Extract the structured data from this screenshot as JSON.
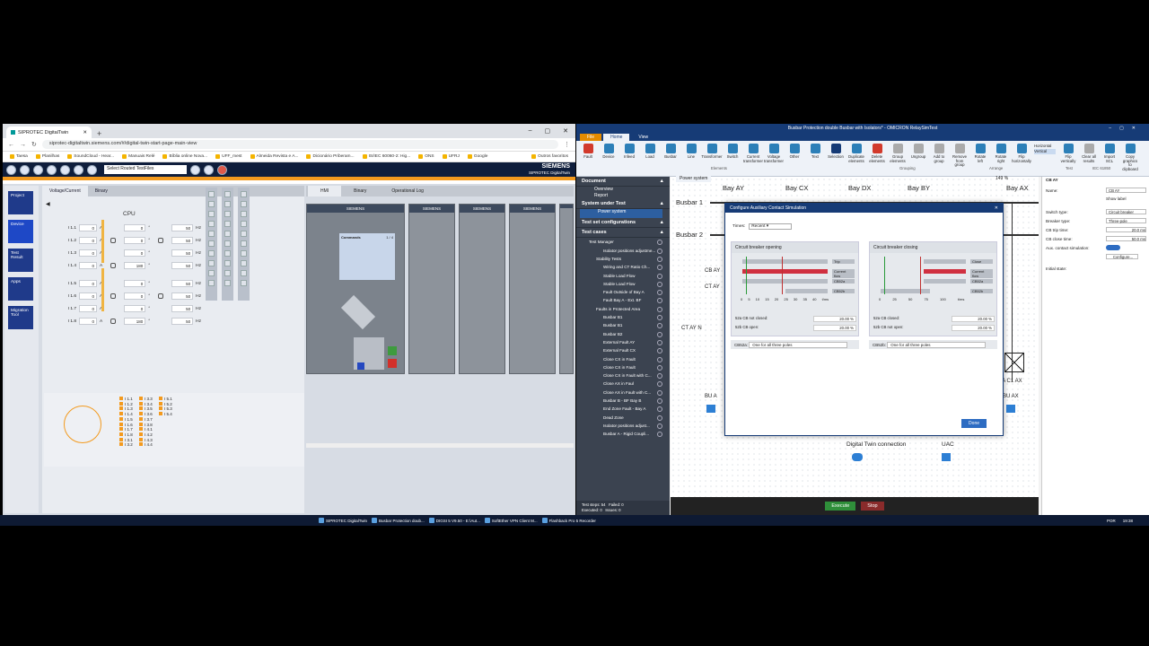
{
  "browser": {
    "tab_title": "SIPROTEC DigitalTwin",
    "url": "siprotec-digitaltwin.siemens.com/#/digital-twin-start-page-main-view",
    "bookmarks": [
      "Taesa",
      "Planilhas",
      "SoundCloud - Hear...",
      "Manuais Relé",
      "Bíblia online Nova...",
      "UFF_mest",
      "Almeida Revista e A...",
      "Dicionário Priberam...",
      "IS/IEC 60060-2: Hig...",
      "ONS",
      "UFRJ",
      "Google",
      "Outros favoritos"
    ]
  },
  "siprotec": {
    "select_label": "Select Routed TestFiles",
    "brand": "SIEMENS",
    "brand_sub": "SIPROTEC DigitalTwin",
    "nav": [
      "Project",
      "Device",
      "Test Result",
      "Apps",
      "Migration Tool"
    ],
    "tabs": [
      "Voltage/Current",
      "Binary"
    ],
    "cpu_title": "CPU",
    "rows": [
      {
        "label": "I 1.1",
        "amp": "0",
        "unit": "A",
        "angle": "0",
        "deg": "°",
        "freq": "50",
        "hz": "Hz"
      },
      {
        "label": "I 1.2",
        "amp": "0",
        "unit": "A",
        "angle": "0",
        "deg": "°",
        "freq": "50",
        "hz": "Hz"
      },
      {
        "label": "I 1.3",
        "amp": "0",
        "unit": "A",
        "angle": "0",
        "deg": "°",
        "freq": "50",
        "hz": "Hz"
      },
      {
        "label": "I 1.4",
        "amp": "0",
        "unit": "A",
        "angle": "180",
        "deg": "°",
        "freq": "50",
        "hz": "Hz"
      },
      {
        "label": "I 1.5",
        "amp": "0",
        "unit": "A",
        "angle": "0",
        "deg": "°",
        "freq": "50",
        "hz": "Hz"
      },
      {
        "label": "I 1.6",
        "amp": "0",
        "unit": "A",
        "angle": "0",
        "deg": "°",
        "freq": "50",
        "hz": "Hz"
      },
      {
        "label": "I 1.7",
        "amp": "0",
        "unit": "A",
        "angle": "0",
        "deg": "°",
        "freq": "50",
        "hz": "Hz"
      },
      {
        "label": "I 1.8",
        "amp": "0",
        "unit": "A",
        "angle": "180",
        "deg": "°",
        "freq": "50",
        "hz": "Hz"
      }
    ],
    "legend_col1": [
      "I 1.1",
      "I 1.2",
      "I 1.3",
      "I 1.4",
      "I 1.5",
      "I 1.6",
      "I 1.7",
      "I 1.8",
      "I 3.1",
      "I 3.2"
    ],
    "legend_col2": [
      "I 3.3",
      "I 3.4",
      "I 3.5",
      "I 3.6",
      "I 3.7",
      "I 3.8",
      "I 4.1",
      "I 4.2",
      "I 4.3",
      "I 4.4"
    ],
    "legend_col3": [
      "I 5.1",
      "I 5.2",
      "I 5.3",
      "I 5.4"
    ],
    "hmi_tabs": [
      "HMI",
      "Binary",
      "Operational Log"
    ],
    "lcd_title": "Commands",
    "lcd_page": "1 / 4",
    "device_labels": [
      "SIEMENS",
      "SIPROTEC"
    ]
  },
  "omicron": {
    "title": "Busbar Protection double Busbar with Isolators* - OMICRON RelaySimTest",
    "ribbon_tabs": [
      "File",
      "Home",
      "View"
    ],
    "ribbon_items": [
      "Fault",
      "Device",
      "Infeed",
      "Load",
      "Busbar",
      "Line",
      "Transformer",
      "Switch",
      "Current transformer",
      "Voltage transformer",
      "Other",
      "Text",
      "Selection",
      "Duplicate elements",
      "Delete elements",
      "Group elements",
      "Ungroup",
      "Add to group",
      "Remove from group",
      "Rotate left",
      "Rotate right",
      "Flip horizontally",
      "Flip vertically",
      "Clear all results",
      "Import SCL",
      "Copy graphics to clipboard"
    ],
    "ribbon_groups": [
      "Elements",
      "Grouping",
      "Arrange",
      "Test",
      "IEC 61850"
    ],
    "ribbon_orient": [
      "Horizontal",
      "Vertical"
    ],
    "doc_header": "Document",
    "doc_items": [
      "Overview",
      "Report"
    ],
    "sut_header": "System under Test",
    "sut_items": [
      "Power system"
    ],
    "tsc_header": "Test set configurations",
    "tc_header": "Test cases",
    "test_cases": [
      "Test Manager",
      "Isolator positions adjustme...",
      "Stability Tests",
      "Wiring and CT Ratio Ch...",
      "Stable Load Flow",
      "Stable Load Flow",
      "Fault Outside of Bay A",
      "Fault Bay A - Ext. BF",
      "Faults in Protected Area",
      "Busbar B1",
      "Busbar B1",
      "Busbar B2",
      "External Fault AY",
      "External Fault CX",
      "Close CX in Fault",
      "Close CX in Fault",
      "Close CX in Fault with C...",
      "Close AX in Faul",
      "Close AX in Fault with C...",
      "Busbar B - BF Bay B",
      "End Zone Fault - Bay A",
      "Dead Zone",
      "Isolator positions adjust...",
      "Busbar A - Rigid Coupli..."
    ],
    "footer": {
      "steps_label": "Test steps:",
      "steps": "54",
      "failed_label": "Failed:",
      "failed": "0",
      "executed_label": "Executed:",
      "executed": "0",
      "issues_label": "Issues:",
      "issues": "0"
    },
    "canvas_tab": "Power system",
    "zoom": "149 %",
    "bays": [
      "Bay AY",
      "Bay CX",
      "Bay DX",
      "Bay BY",
      "Bay AX"
    ],
    "busbars": [
      "Busbar 1",
      "Busbar 2"
    ],
    "labels": [
      "CT AY N",
      "Digital Twin connection",
      "UAC",
      "TA C1 AX",
      "BU AX",
      "BU A",
      "CB AY",
      "CT AY"
    ],
    "exec": {
      "execute": "Execute",
      "stop": "Stop"
    },
    "props": {
      "header": "CB AY",
      "name_label": "Name:",
      "name": "CB AY",
      "show_label": "Show label",
      "switch_type_label": "Switch type:",
      "switch_type": "Circuit breaker",
      "breaker_type_label": "Breaker type:",
      "breaker_type": "Three-pole",
      "trip_label": "CB trip time:",
      "trip": "20.0 ms",
      "close_label": "CB close time:",
      "close": "50.0 ms",
      "aux_label": "Aux. contact simulation:",
      "configure": "Configure...",
      "initial_label": "Initial state:"
    },
    "dialog": {
      "title": "Configure Auxiliary Contact Simulation",
      "times_label": "Times:",
      "times": "Recent",
      "opening": "Circuit breaker opening",
      "closing": "Circuit breaker closing",
      "open_traces": [
        "Trip",
        "Current flow",
        "CB52a",
        "CB52b"
      ],
      "close_traces": [
        "Close",
        "Current flow",
        "CB52a",
        "CB52b"
      ],
      "open_axis": "0 5 10 15 20 25 30 35 40",
      "close_axis": "0 25 50 75 100",
      "unit": "t/ms",
      "open_pct": [
        {
          "label": "52a CB not closed:",
          "value": "20.00 %"
        },
        {
          "label": "52b CB open:",
          "value": "20.00 %"
        }
      ],
      "close_pct": [
        {
          "label": "52a CB closed:",
          "value": "20.00 %"
        },
        {
          "label": "52b CB not open:",
          "value": "20.00 %"
        }
      ],
      "dd_a_label": "CB52a:",
      "dd_a": "One for all three poles",
      "dd_b_label": "CB52b:",
      "dd_b": "One for all three poles",
      "done": "Done"
    }
  },
  "taskbar": {
    "apps": [
      "SIPROTEC DigitalTwin",
      "Busbar Protection doub...",
      "DIGSI 5 V9.50 - E:\\Aut...",
      "SoftEther VPN Client M...",
      "Flashback Pro 5 Recorder"
    ],
    "lang": "POR",
    "time": "19:38"
  }
}
